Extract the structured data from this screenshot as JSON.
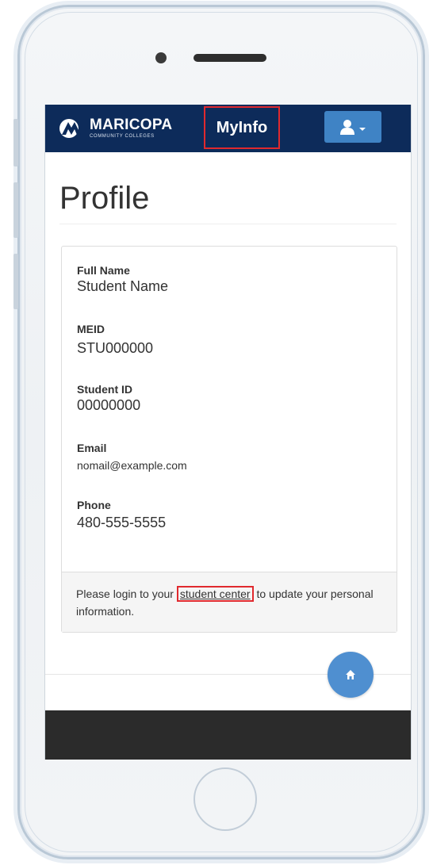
{
  "header": {
    "brand_name": "MARICOPA",
    "brand_subtitle": "COMMUNITY COLLEGES",
    "app_title": "MyInfo",
    "user_menu_icon": "user-icon"
  },
  "page": {
    "title": "Profile"
  },
  "profile": {
    "fields": [
      {
        "label": "Full Name",
        "value": "Student Name"
      },
      {
        "label": "MEID",
        "value": "STU000000"
      },
      {
        "label": "Student ID",
        "value": "00000000"
      },
      {
        "label": "Email",
        "value": "nomail@example.com"
      },
      {
        "label": "Phone",
        "value": "480-555-5555"
      }
    ],
    "footer": {
      "text_before": "Please login to your ",
      "link_text": "student center",
      "text_after": " to update your personal information."
    }
  },
  "fab": {
    "icon": "home-icon"
  },
  "colors": {
    "navbar": "#0d2b5a",
    "highlight": "#e0292e",
    "accent": "#3f83c5"
  }
}
